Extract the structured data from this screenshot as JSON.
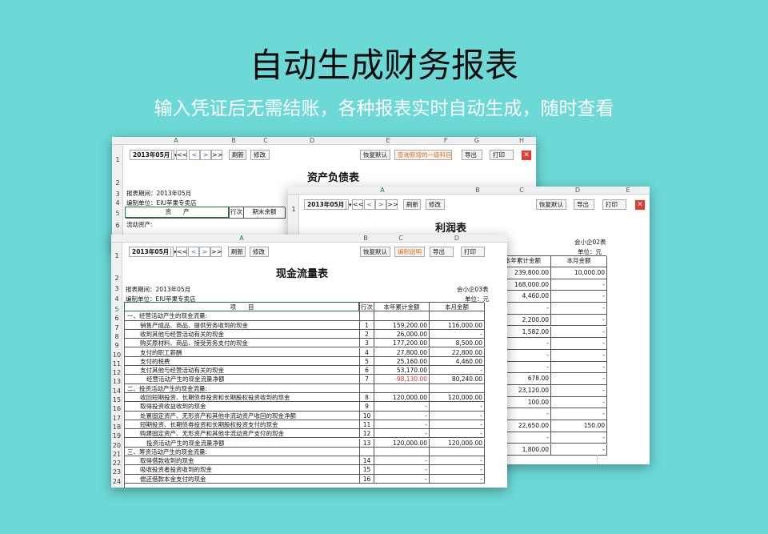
{
  "hero": {
    "title": "自动生成财务报表",
    "subtitle": "输入凭证后无需结账，各种报表实时自动生成，随时查看"
  },
  "balance_sheet": {
    "columns": [
      "A",
      "B",
      "C",
      "D",
      "E",
      "F",
      "G",
      "H"
    ],
    "period": "2013年05月",
    "nav": [
      "<<",
      "<",
      ">",
      ">>"
    ],
    "buttons": {
      "refresh": "刷新",
      "edit": "修改",
      "restore": "恢复默认",
      "query_new": "查询新增的一级科目",
      "export": "导出",
      "print": "打印",
      "close": "✕"
    },
    "title": "资产负债表",
    "period_label": "报表期间：2013年05月",
    "unit_label": "编制单位：EIU苹果专卖店",
    "headers": [
      "资　　产",
      "行次",
      "期末余额"
    ],
    "section": "流动资产:",
    "rows": [
      "1",
      "2",
      "3",
      "4",
      "5",
      "6"
    ]
  },
  "income_statement": {
    "columns": [
      "A",
      "B",
      "C",
      "D",
      "E"
    ],
    "period": "2013年05月",
    "nav": [
      "<<",
      "<",
      ">",
      ">>"
    ],
    "buttons": {
      "refresh": "刷新",
      "edit": "修改",
      "restore": "恢复默认",
      "export": "导出",
      "print": "打印",
      "close": "✕"
    },
    "title": "利润表",
    "form_no": "会小企02表",
    "unit": "单位：元",
    "headers": [
      "本年累计金额",
      "本月金额"
    ],
    "rows": [
      [
        "239,800.00",
        "10,000.00"
      ],
      [
        "168,000.00",
        "-"
      ],
      [
        "4,460.00",
        "-"
      ],
      [
        "-",
        "-"
      ],
      [
        "2,200.00",
        "-"
      ],
      [
        "1,582.00",
        "-"
      ],
      [
        "-",
        "-"
      ],
      [
        "-",
        "-"
      ],
      [
        "-",
        "-"
      ],
      [
        "678.00",
        "-"
      ],
      [
        "23,120.00",
        "-"
      ],
      [
        "100.00",
        "-"
      ],
      [
        "-",
        "-"
      ],
      [
        "22,650.00",
        "150.00"
      ],
      [
        "-",
        "-"
      ],
      [
        "1,800.00",
        "-"
      ]
    ],
    "row_numbers": [
      "1",
      "2"
    ]
  },
  "cash_flow": {
    "columns": [
      "A",
      "B",
      "C",
      "D"
    ],
    "period": "2013年05月",
    "nav": [
      "<<",
      "<",
      ">",
      ">>"
    ],
    "buttons": {
      "refresh": "刷新",
      "edit": "修改",
      "restore": "恢复默认",
      "instructions": "编制说明",
      "export": "导出",
      "print": "打印"
    },
    "title": "现金流量表",
    "period_label": "报表期间：2013年05月",
    "unit_label": "编制单位：EIU苹果专卖店",
    "form_no": "会小企03表",
    "unit": "单位：元",
    "headers": [
      "项　　目",
      "行次",
      "本年累计金额",
      "本月金额"
    ],
    "row_numbers": [
      "1",
      "2",
      "3",
      "4",
      "5",
      "6",
      "7",
      "8",
      "9",
      "10",
      "11",
      "12",
      "13",
      "14",
      "15",
      "16",
      "17",
      "18",
      "19",
      "20",
      "21",
      "22",
      "23",
      "24"
    ],
    "rows": [
      {
        "item": "一、经营活动产生的现金流量:",
        "line": "",
        "ytd": "",
        "month": "",
        "indent": 0
      },
      {
        "item": "销售产成品、商品、提供劳务收到的现金",
        "line": "1",
        "ytd": "159,200.00",
        "month": "116,000.00",
        "indent": 2
      },
      {
        "item": "收到其他与经营活动有关的现金",
        "line": "2",
        "ytd": "26,000.00",
        "month": "-",
        "indent": 2
      },
      {
        "item": "购买原材料、商品、接受劳务支付的现金",
        "line": "3",
        "ytd": "177,200.00",
        "month": "8,500.00",
        "indent": 2
      },
      {
        "item": "支付的职工薪酬",
        "line": "4",
        "ytd": "27,800.00",
        "month": "22,800.00",
        "indent": 2
      },
      {
        "item": "支付的税费",
        "line": "5",
        "ytd": "25,160.00",
        "month": "4,460.00",
        "indent": 2
      },
      {
        "item": "支付其他与经营活动有关的现金",
        "line": "6",
        "ytd": "53,170.00",
        "month": "-",
        "indent": 2
      },
      {
        "item": "经营活动产生的现金流量净额",
        "line": "7",
        "ytd": "-98,130.00",
        "month": "80,240.00",
        "indent": 3,
        "neg": true
      },
      {
        "item": "二、投资活动产生的现金流量:",
        "line": "",
        "ytd": "",
        "month": "",
        "indent": 0
      },
      {
        "item": "收回短期投资、长期债券投资和长期股权投资收到的现金",
        "line": "8",
        "ytd": "120,000.00",
        "month": "120,000.00",
        "indent": 2
      },
      {
        "item": "取得投资收益收到的现金",
        "line": "9",
        "ytd": "-",
        "month": "-",
        "indent": 2
      },
      {
        "item": "处置固定资产、无形资产和其他非流动资产收回的现金净额",
        "line": "10",
        "ytd": "-",
        "month": "-",
        "indent": 2
      },
      {
        "item": "短期投资、长期债券投资和长期股权投资支付的现金",
        "line": "11",
        "ytd": "-",
        "month": "-",
        "indent": 2
      },
      {
        "item": "购建固定资产、无形资产和其他非流动资产支付的现金",
        "line": "12",
        "ytd": "-",
        "month": "-",
        "indent": 2
      },
      {
        "item": "投资活动产生的现金流量净额",
        "line": "13",
        "ytd": "120,000.00",
        "month": "120,000.00",
        "indent": 3
      },
      {
        "item": "三、筹资活动产生的现金流量:",
        "line": "",
        "ytd": "",
        "month": "",
        "indent": 0
      },
      {
        "item": "取得借款收到的现金",
        "line": "14",
        "ytd": "-",
        "month": "-",
        "indent": 2
      },
      {
        "item": "吸收投资者投资收到的现金",
        "line": "15",
        "ytd": "-",
        "month": "-",
        "indent": 2
      },
      {
        "item": "偿还借款本金支付的现金",
        "line": "16",
        "ytd": "-",
        "month": "-",
        "indent": 2
      }
    ]
  }
}
